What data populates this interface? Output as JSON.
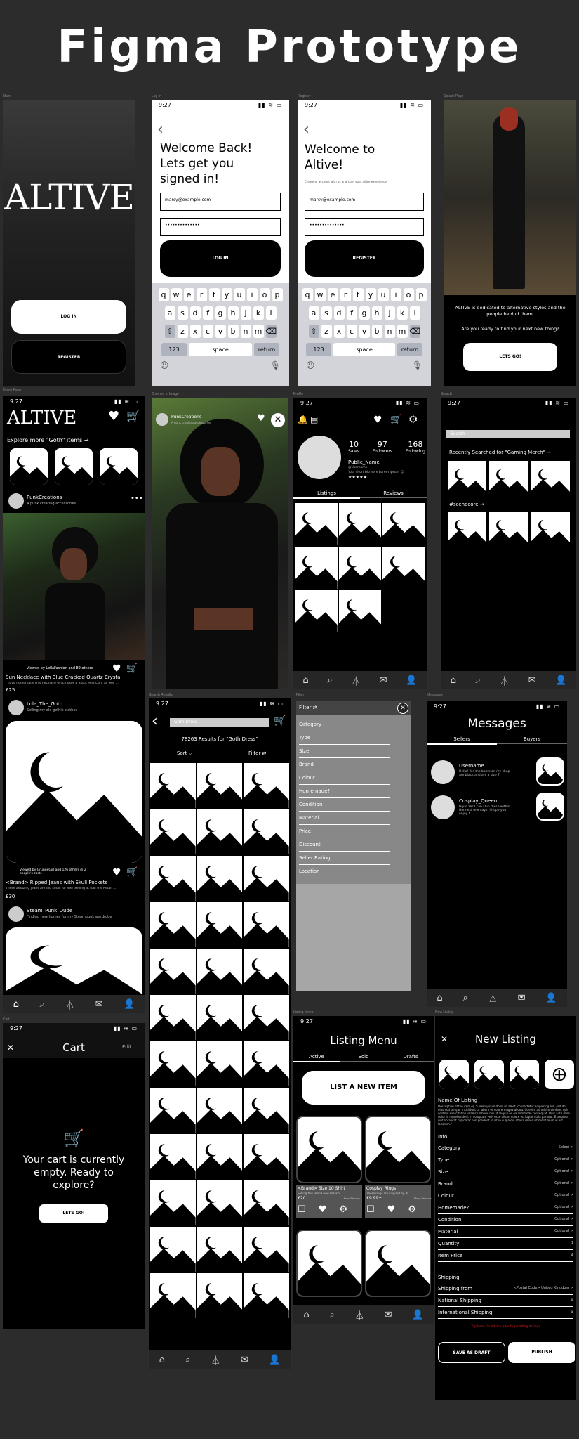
{
  "title": "Figma Prototype",
  "labels": {
    "main": "Main",
    "login": "Log In",
    "register": "Register",
    "splash": "Splash Page",
    "home": "Home Page",
    "zoomed": "Zoomed in Image",
    "profile": "Profile",
    "search": "Search",
    "results": "Search Results",
    "filter": "Filter",
    "messages": "Messages",
    "cart": "Cart",
    "listing_menu": "Listing Menu",
    "new_listing": "New Listing"
  },
  "time": "9:27",
  "main": {
    "brand": "ALTIVE",
    "login": "LOG IN",
    "register": "REGISTER"
  },
  "login": {
    "heading": "Welcome Back! Lets get you signed in!",
    "email": "marcy@example.com",
    "password": "••••••••••••••",
    "button": "LOG IN"
  },
  "register": {
    "heading": "Welcome to Altive!",
    "sub": "Create or account with us and start your altive experience",
    "email": "marcy@example.com",
    "password": "••••••••••••••",
    "button": "REGISTER"
  },
  "keyboard": {
    "row1": [
      "q",
      "w",
      "e",
      "r",
      "t",
      "y",
      "u",
      "i",
      "o",
      "p"
    ],
    "row2": [
      "a",
      "s",
      "d",
      "f",
      "g",
      "h",
      "j",
      "k",
      "l"
    ],
    "row3": [
      "z",
      "x",
      "c",
      "v",
      "b",
      "n",
      "m"
    ],
    "num": "123",
    "space": "space",
    "ret": "return"
  },
  "splash": {
    "tagline": "ALTIVE is dedicated to alternative styles and the people behind them.",
    "question": "Are you ready to find your next new thing?",
    "button": "LETS GO!"
  },
  "home": {
    "brand": "ALTIVE",
    "explore": "Explore more \"Goth\" items →",
    "user1": "PunkCreations",
    "user1_sub": "A punk creating accessories",
    "viewed1": "Viewed by LollaFashion and 89 others",
    "item1": "Sun Necklace with Blue Cracked Quartz Crystal",
    "item1_desc": "I have homemade this necklace which uses a Black Mist Card as well ...",
    "price1": "£25",
    "user2": "Lola_The_Goth",
    "user2_sub": "Selling my old gothic clothes",
    "viewed2": "Viewed by GrungeGirl and 126 others in 2 people's carts",
    "item2": "<Brand> Ripped Jeans with Skull Pockets",
    "item2_desc": "These amazing Jeans are too small for me! Selling at half the Retail ...",
    "price2": "£30",
    "user3": "Steam_Punk_Dude",
    "user3_sub": "Finding new homes for my Steampunk wardrobe"
  },
  "zoomed": {
    "user": "PunkCreations",
    "user_sub": "A punk creating accessories"
  },
  "profile": {
    "sales": "10",
    "sales_label": "Sales",
    "followers": "97",
    "followers_label": "Followers",
    "following": "168",
    "following_label": "Following",
    "name": "Public_Name",
    "handle": "@Username",
    "bio": "Your short bio here Lorem Ipsum ☺",
    "stars": "★★★★★",
    "tab1": "Listings",
    "tab2": "Reviews"
  },
  "search": {
    "placeholder": "Search",
    "recent": "Recently Searched for \"Gaming Merch\" →",
    "tag": "#scenecore →"
  },
  "results": {
    "query": "Goth Dress",
    "count": "78263 Results for \"Goth Dress\"",
    "sort": "Sort ⌵",
    "filter": "Filter ⇄"
  },
  "filter": {
    "title": "Filter ⇄",
    "items": [
      "Category",
      "Type",
      "Size",
      "Brand",
      "Colour",
      "Homemade?",
      "Condition",
      "Material",
      "Price",
      "Discount",
      "Seller Rating",
      "Location"
    ]
  },
  "messages": {
    "title": "Messages",
    "tab1": "Sellers",
    "tab2": "Buyers",
    "m1_user": "Username",
    "m1_text": "Hello! Yes the boots on my shop are black and are a size 7!",
    "m2_user": "Cosplay_Queen",
    "m2_text": "Hiya! Yes I can ship these within the next few days! I hope you enjoy t..."
  },
  "cart": {
    "title": "Cart",
    "edit": "Edit",
    "empty": "Your cart is currently empty. Ready to explore?",
    "button": "LETS GO!"
  },
  "listing_menu": {
    "title": "Listing Menu",
    "tab1": "Active",
    "tab2": "Sold",
    "tab3": "Drafts",
    "button": "LIST A NEW ITEM",
    "i1_name": "<Brand> Size 10 Shirt",
    "i1_desc": "Selling this Brand new Black Shirt",
    "i1_price": "£20",
    "i1_badge": "Free Delivery",
    "i2_name": "Cosplay Rings",
    "i2_desc": "These rings are inspired by differ...",
    "i2_price": "£9.99+",
    "i2_badge": "Many Variants"
  },
  "new_listing": {
    "title": "New Listing",
    "name_label": "Name Of Listing",
    "desc": "Description of the item eg \"Lorem ipsum dolor sit amet, consectetur adipiscing elit, sed do eiusmod tempor incididunt ut labore et dolore magna aliqua. Ut enim ad minim veniam, quis nostrud exercitation ullamco laboris nisi ut aliquip ex ea commodo consequat. Duis aute irure dolor in reprehenderit in voluptate velit esse cillum dolore eu fugiat nulla pariatur. Excepteur sint occaecat cupidatat non proident, sunt in culpa qui officia deserunt mollit anim id est laborum.\"",
    "info": "Info",
    "rows": [
      [
        "Category",
        "Select >"
      ],
      [
        "Type",
        "Optional >"
      ],
      [
        "Size",
        "Optional >"
      ],
      [
        "Brand",
        "Optional >"
      ],
      [
        "Colour",
        "Optional >"
      ],
      [
        "Homemade?",
        "Optional >"
      ],
      [
        "Condition",
        "Optional >"
      ],
      [
        "Material",
        "Optional >"
      ],
      [
        "Quantity",
        "1"
      ],
      [
        "Item Price",
        "£"
      ]
    ],
    "shipping": "Shipping",
    "ship_rows": [
      [
        "Shipping from",
        "<Postal Code> United Kingdom >"
      ],
      [
        "National Shipping",
        "£"
      ],
      [
        "International Shipping",
        "£"
      ]
    ],
    "advice": "Tap here for advice about uploading listings",
    "draft": "SAVE AS DRAFT",
    "publish": "PUBLISH"
  }
}
